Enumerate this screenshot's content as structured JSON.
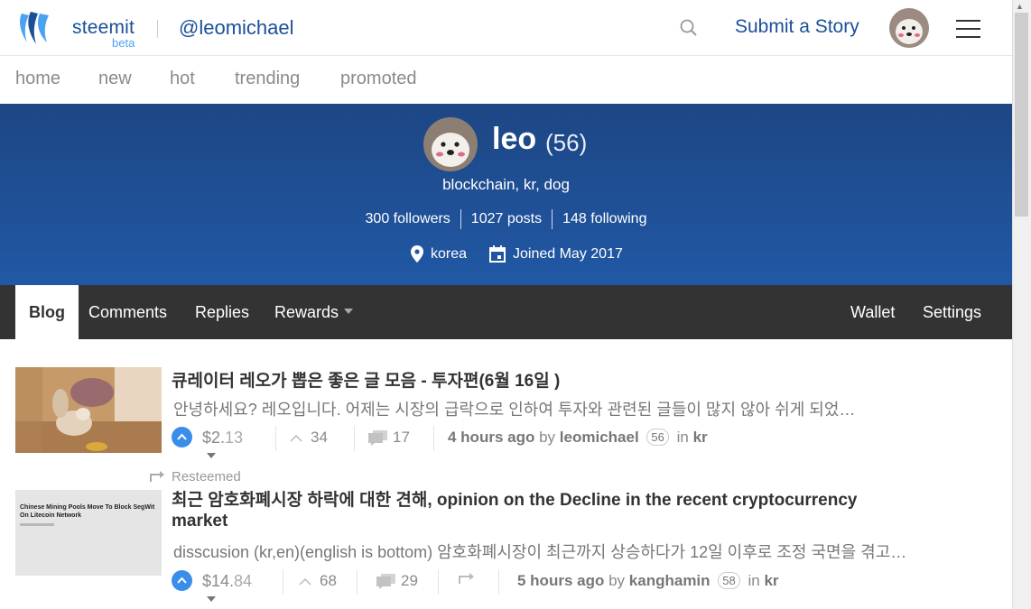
{
  "header": {
    "brand": "steemit",
    "beta": "beta",
    "user_handle": "@leomichael",
    "submit_label": "Submit a Story"
  },
  "subnav": [
    "home",
    "new",
    "hot",
    "trending",
    "promoted"
  ],
  "profile": {
    "name": "leo",
    "reputation": "(56)",
    "about": "blockchain, kr, dog",
    "followers": "300 followers",
    "posts": "1027 posts",
    "following": "148 following",
    "location": "korea",
    "joined": "Joined May 2017"
  },
  "tabs": {
    "blog": "Blog",
    "comments": "Comments",
    "replies": "Replies",
    "rewards": "Rewards",
    "wallet": "Wallet",
    "settings": "Settings"
  },
  "posts": [
    {
      "title": "큐레이터 레오가 뽑은 좋은 글 모음 - 투자편(6월 16일 )",
      "body": "안녕하세요? 레오입니다. 어제는 시장의 급락으로 인하여 투자와 관련된 글들이 많지 않아 쉬게 되었…",
      "payout_main": "$2.",
      "payout_cents": "13",
      "votes": "34",
      "comments": "17",
      "time": "4 hours ago",
      "by": "by",
      "author": "leomichael",
      "author_rep": "56",
      "in": "in",
      "category": "kr"
    },
    {
      "resteemed": "Resteemed",
      "title_line1": "최근 암호화폐시장 하락에 대한 견해, opinion on the Decline in the recent cryptocurrency",
      "title_line2": "market",
      "thumb_headline": "Chinese Mining Pools Move To Block SegWit On Litecoin Network",
      "body": "disscusion (kr,en)(english is bottom) 암호화폐시장이 최근까지 상승하다가 12일 이후로 조정 국면을 겪고…",
      "payout_main": "$14.",
      "payout_cents": "84",
      "votes": "68",
      "comments": "29",
      "time": "5 hours ago",
      "by": "by",
      "author": "kanghamin",
      "author_rep": "58",
      "in": "in",
      "category": "kr"
    }
  ],
  "colors": {
    "brand_blue": "#1a5099",
    "banner_top": "#1d4684",
    "banner_bottom": "#2158a5",
    "tabbar_bg": "#333333",
    "vote_blue": "#3a8eea"
  },
  "icons": [
    "steemit-logo-icon",
    "search-icon",
    "menu-icon",
    "location-pin-icon",
    "calendar-icon",
    "upvote-icon",
    "dropdown-caret-icon",
    "votes-icon",
    "comments-icon",
    "resteem-icon"
  ]
}
